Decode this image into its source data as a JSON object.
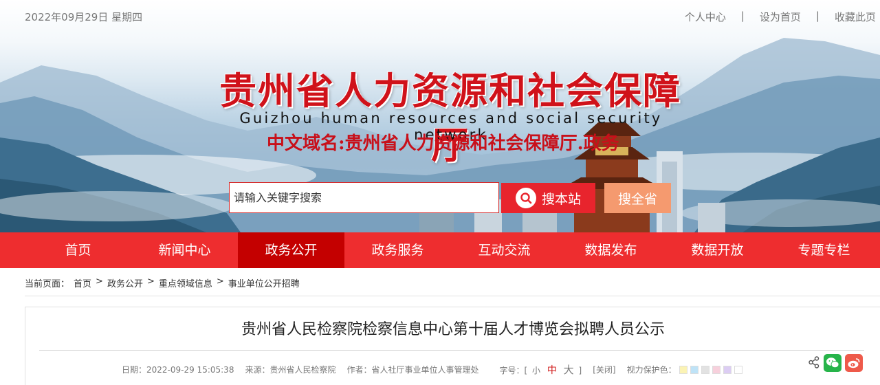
{
  "topbar": {
    "date": "2022年09月29日 星期四",
    "links": [
      "个人中心",
      "设为首页",
      "收藏此页"
    ],
    "separator": "|"
  },
  "logo": {
    "title_cn": "贵州省人力资源和社会保障厅",
    "title_en": "Guizhou human resources and social security network",
    "domain": "中文域名:贵州省人力资源和社会保障厅.政务"
  },
  "search": {
    "placeholder": "请输入关键字搜索",
    "site_button": "搜本站",
    "all_button": "搜全省"
  },
  "nav": {
    "items": [
      "首页",
      "新闻中心",
      "政务公开",
      "政务服务",
      "互动交流",
      "数据发布",
      "数据开放",
      "专题专栏"
    ],
    "active_index": 2
  },
  "breadcrumb": {
    "prefix": "当前页面：",
    "items": [
      "首页",
      "政务公开",
      "重点领域信息",
      "事业单位公开招聘"
    ],
    "separator": ">"
  },
  "article": {
    "title": "贵州省人民检察院检察信息中心第十届人才博览会拟聘人员公示",
    "date": "日期：2022-09-29 15:05:38",
    "source": "来源：贵州省人民检察院",
    "author": "作者：省人社厅事业单位人事管理处",
    "font_size_label": "字号：[",
    "font_small": "小",
    "font_mid": "中",
    "font_big": "大",
    "font_close": "]",
    "close_label": "[关闭]",
    "eye_label": "视力保护色：",
    "eye_colors": [
      "#fbf3b4",
      "#bfe3f7",
      "#e2e2e2",
      "#f7d0dc",
      "#dccdf3",
      "#ffffff"
    ]
  },
  "colors": {
    "nav_bg": "#ee2d2f",
    "nav_active": "#c40000",
    "brand_red": "#d0121a",
    "search_all": "#f59a6f"
  },
  "icons": [
    "search-icon",
    "share-icon",
    "wechat-icon",
    "weibo-icon"
  ]
}
